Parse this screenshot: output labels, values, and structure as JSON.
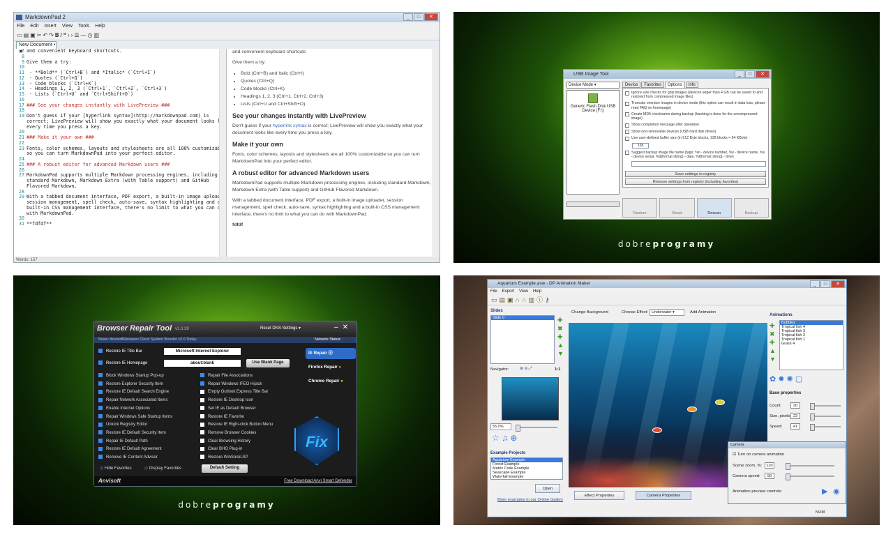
{
  "markdownpad": {
    "title": "MarkdownPad 2",
    "menu": [
      "File",
      "Edit",
      "Insert",
      "View",
      "Tools",
      "Help"
    ],
    "tab": "New Document • ✖",
    "editor_lines": [
      {
        "n": "7",
        "t": "and convenient keyboard shortcuts.",
        "c": ""
      },
      {
        "n": "8",
        "t": "",
        "c": ""
      },
      {
        "n": "9",
        "t": "Give them a try:",
        "c": ""
      },
      {
        "n": "10",
        "t": "",
        "c": ""
      },
      {
        "n": "11",
        "t": " - **Bold** (`Ctrl+B`) and *Italic* (`Ctrl+I`)",
        "c": ""
      },
      {
        "n": "12",
        "t": " - Quotes (`Ctrl+Q`)",
        "c": ""
      },
      {
        "n": "13",
        "t": " - Code blocks (`Ctrl+K`)",
        "c": ""
      },
      {
        "n": "14",
        "t": " - Headings 1, 2, 3 (`Ctrl+1`, `Ctrl+2`, `Ctrl+3`)",
        "c": ""
      },
      {
        "n": "15",
        "t": " - Lists (`Ctrl+U` and `Ctrl+Shift+O`)",
        "c": ""
      },
      {
        "n": "16",
        "t": "",
        "c": ""
      },
      {
        "n": "17",
        "t": "### See your changes instantly with LivePreview ###",
        "c": "h"
      },
      {
        "n": "18",
        "t": "",
        "c": ""
      },
      {
        "n": "19",
        "t": "Don't guess if your [hyperlink syntax](http://markdownpad.com) is",
        "c": ""
      },
      {
        "n": "",
        "t": "correct; LivePreview will show you exactly what your document looks like",
        "c": ""
      },
      {
        "n": "",
        "t": "every time you press a key.",
        "c": ""
      },
      {
        "n": "20",
        "t": "",
        "c": ""
      },
      {
        "n": "21",
        "t": "### Make it your own ###",
        "c": "h"
      },
      {
        "n": "22",
        "t": "",
        "c": ""
      },
      {
        "n": "23",
        "t": "Fonts, color schemes, layouts and stylesheets are all 100% customizable",
        "c": ""
      },
      {
        "n": "",
        "t": "so you can turn MarkdownPad into your perfect editor.",
        "c": ""
      },
      {
        "n": "24",
        "t": "",
        "c": ""
      },
      {
        "n": "25",
        "t": "### A robust editor for advanced Markdown users ###",
        "c": "h"
      },
      {
        "n": "26",
        "t": "",
        "c": ""
      },
      {
        "n": "27",
        "t": "MarkdownPad supports multiple Markdown processing engines, including",
        "c": ""
      },
      {
        "n": "",
        "t": "standard Markdown, Markdown Extra (with Table support) and GitHub",
        "c": ""
      },
      {
        "n": "",
        "t": "Flavored Markdown.",
        "c": ""
      },
      {
        "n": "28",
        "t": "",
        "c": ""
      },
      {
        "n": "29",
        "t": "With a tabbed document interface, PDF export, a built-in image uploader,",
        "c": ""
      },
      {
        "n": "",
        "t": "session management, spell check, auto-save, syntax highlighting and a",
        "c": ""
      },
      {
        "n": "",
        "t": "built-in CSS management interface, there's no limit to what you can do",
        "c": ""
      },
      {
        "n": "",
        "t": "with MarkdownPad.",
        "c": ""
      },
      {
        "n": "30",
        "t": "",
        "c": ""
      },
      {
        "n": "31",
        "t": "**fdfdf**",
        "c": ""
      }
    ],
    "preview": {
      "intro": "and convenient keyboard shortcuts",
      "try": "Give them a try:",
      "items": [
        "Bold (Ctrl+B) and Italic (Ctrl+I)",
        "Quotes (Ctrl+Q)",
        "Code blocks (Ctrl+K)",
        "Headings 1, 2, 3 (Ctrl+1, Ctrl+2, Ctrl+3)",
        "Lists (Ctrl+U and Ctrl+Shift+O)"
      ],
      "h1": "See your changes instantly with LivePreview",
      "p1a": "Don't guess if your",
      "p1link": "hyperlink syntax",
      "p1b": "is correct; LivePreview will show you exactly what your document looks like every time you press a key.",
      "h2": "Make it your own",
      "p2": "Fonts, color schemes, layouts and stylesheets are all 100% customizable so you can turn MarkdownPad into your perfect editor.",
      "h3": "A robust editor for advanced Markdown users",
      "p3": "MarkdownPad supports multiple Markdown processing engines, including standard Markdown, Markdown Extra (with Table support) and GitHub Flavored Markdown.",
      "p4": "With a tabbed document interface, PDF export, a built-in image uploader, session management, spell check, auto-save, syntax highlighting and a built-in CSS management interface, there's no limit to what you can do with MarkdownPad.",
      "p5": "fdfdf"
    },
    "status": "Words: 157"
  },
  "usb": {
    "title": "USB Image Tool",
    "mode": "Device Mode",
    "device": "Generic Flash Disk USB Device (F:\\)",
    "tabs": [
      "Device",
      "Favorites",
      "Options",
      "Info"
    ],
    "options": [
      {
        "t": "Ignore size checks for gzip images (devices larger than 4 GB can be saved to and restored from compressed image files)",
        "on": false
      },
      {
        "t": "Truncate oversize images in device mode (this option can result in data loss, please read FAQ on homepage)",
        "on": false
      },
      {
        "t": "Create MD5 checksums during backup (hashing is done for the uncompressed image)",
        "on": false
      },
      {
        "t": "Show completion message after operation",
        "on": false
      },
      {
        "t": "Show non-removable devices (USB hard disk drives)",
        "on": false
      },
      {
        "t": "Use user-defined buffer size (in 512 Byte blocks, 128 blocks = 64 KByte)",
        "on": false
      },
      {
        "t": "Suggest backup image file name (tags: %n - device number, %x - device name, %s - device serial, %d{format string} - date, %t{format string} - time)",
        "on": false
      }
    ],
    "buffer": "128",
    "save_btn": "Save settings to registry",
    "remove_btn": "Remove settings from registry (including favorites)",
    "actions": [
      "Restore",
      "Reset",
      "Rescan",
      "Backup"
    ],
    "brand_light": "dobre",
    "brand_bold": "programy"
  },
  "repair": {
    "title": "Browser Repair Tool",
    "version": "v1.0.39",
    "reset": "Reset DNS Settings",
    "news": "News: AnvisoftReleases Cloud System Booster v2.0 Today",
    "network": "Network Status:",
    "title_bar_label": "Restore IE Title Bar",
    "title_bar_value": "Microsoft Internet Explorer",
    "homepage_label": "Restore IE Homepage",
    "homepage_value": "about:blank",
    "blank_btn": "Use Blank Page",
    "left_items": [
      {
        "t": "Block Windows Startup Pop-up",
        "on": true
      },
      {
        "t": "Restore Explorer Security Item",
        "on": true
      },
      {
        "t": "Restore IE Default Search Engine",
        "on": true
      },
      {
        "t": "Repair Network Associated Items",
        "on": true
      },
      {
        "t": "Enable Internet Options",
        "on": true
      },
      {
        "t": "Repair Windows Safe Startup Items",
        "on": true
      },
      {
        "t": "Unlock Registry Editor",
        "on": true
      },
      {
        "t": "Restore IE Default Security Item",
        "on": true
      },
      {
        "t": "Repair IE Default Path",
        "on": true
      },
      {
        "t": "Restore IE Default Agreement",
        "on": true
      },
      {
        "t": "Remove IE Content Advisor",
        "on": true
      }
    ],
    "right_items": [
      {
        "t": "Repair File Associations",
        "on": true
      },
      {
        "t": "Repair Windows IFEO Hijack",
        "on": true
      },
      {
        "t": "Empty Outlook Express Title Bar",
        "on": false
      },
      {
        "t": "Restore IE Desktop Icon",
        "on": false
      },
      {
        "t": "Set IE as Default Browser",
        "on": false
      },
      {
        "t": "Restore IE Favorite",
        "on": false
      },
      {
        "t": "Restore IE Right-click Button Menu",
        "on": false
      },
      {
        "t": "Remove Browser Cookies",
        "on": false
      },
      {
        "t": "Clear Browsing History",
        "on": false
      },
      {
        "t": "Clear BHO Plug-in",
        "on": false
      },
      {
        "t": "Restore WinSockLSP",
        "on": false
      }
    ],
    "side": [
      "IE Repair",
      "Firefox Repair",
      "Chrome Repair"
    ],
    "fix": "Fix",
    "hide_fav": "Hide Favorites",
    "display_fav": "Display Favorites",
    "default_btn": "Default Setting",
    "logo": "Anvisoft",
    "download": "Free Download Anvi Smart Defender",
    "brand_light": "dobre",
    "brand_bold": "programy"
  },
  "dp": {
    "title": "Aquarium Example.asw - DP Animation Maker",
    "menu": [
      "File",
      "Export",
      "View",
      "Help"
    ],
    "slides_label": "Slides",
    "slide1": "Slide 0",
    "change_bg": "Change Background",
    "choose_effect": "Choose Effect:",
    "effect": "Underwater",
    "add_anim": "Add Animation",
    "animations_label": "Animations",
    "animations": [
      "Bubbles",
      "Tropical fish 4",
      "Tropical fish 3",
      "Tropical fish 2",
      "Tropical fish 1",
      "Grass 4"
    ],
    "navigator": "Navigator:",
    "ratio": "1:1",
    "zoom": "55.0%",
    "base_props": "Base properties",
    "count_lbl": "Count:",
    "count": "30",
    "size_lbl": "Size, pixels:",
    "size": "23",
    "speed_lbl": "Speed:",
    "speed": "41",
    "examples_label": "Example Projects",
    "examples": [
      "Aquarium Example",
      "Forest Example",
      "Matrix Code Example",
      "Seascape Example",
      "Waterfall Example"
    ],
    "open": "Open",
    "more": "More examples in our Online Gallery",
    "effect_props": "Effect Properties",
    "camera_props": "Camera Properties",
    "camera": "Camera",
    "cam_anim": "Turn on camera animation",
    "scene_zoom_lbl": "Scene zoom, %:",
    "scene_zoom": "120",
    "cam_speed_lbl": "Camera speed:",
    "cam_speed": "50",
    "preview_ctrl": "Animation preview controls:",
    "num": "NUM"
  }
}
